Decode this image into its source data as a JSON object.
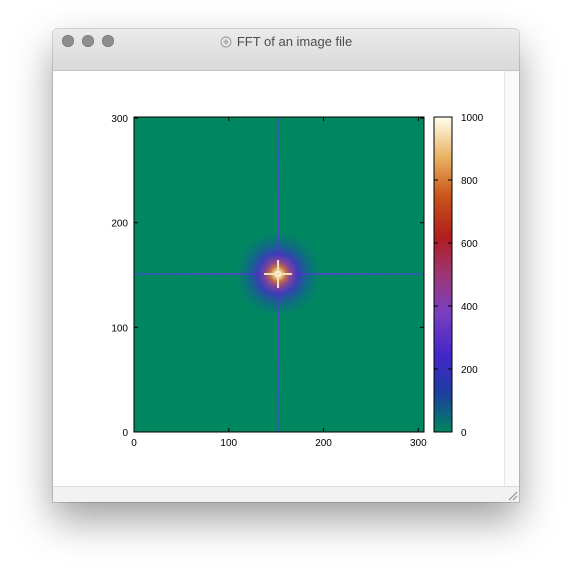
{
  "window": {
    "title": "FFT of an image file"
  },
  "chart_data": {
    "type": "heatmap",
    "title": "",
    "xlabel": "",
    "ylabel": "",
    "xlim": [
      0,
      306
    ],
    "ylim": [
      0,
      301
    ],
    "x_ticks": [
      "0",
      "100",
      "200",
      "300"
    ],
    "y_ticks": [
      "0",
      "100",
      "200",
      "300"
    ],
    "colorbar": {
      "range": [
        0,
        1000
      ],
      "ticks": [
        "0",
        "200",
        "400",
        "600",
        "800",
        "1000"
      ]
    },
    "peak": {
      "x": 152,
      "y": 151,
      "value": 1000
    },
    "background_value": 0,
    "background_color": "#00875f",
    "cross_color": "#2f4fb0"
  }
}
